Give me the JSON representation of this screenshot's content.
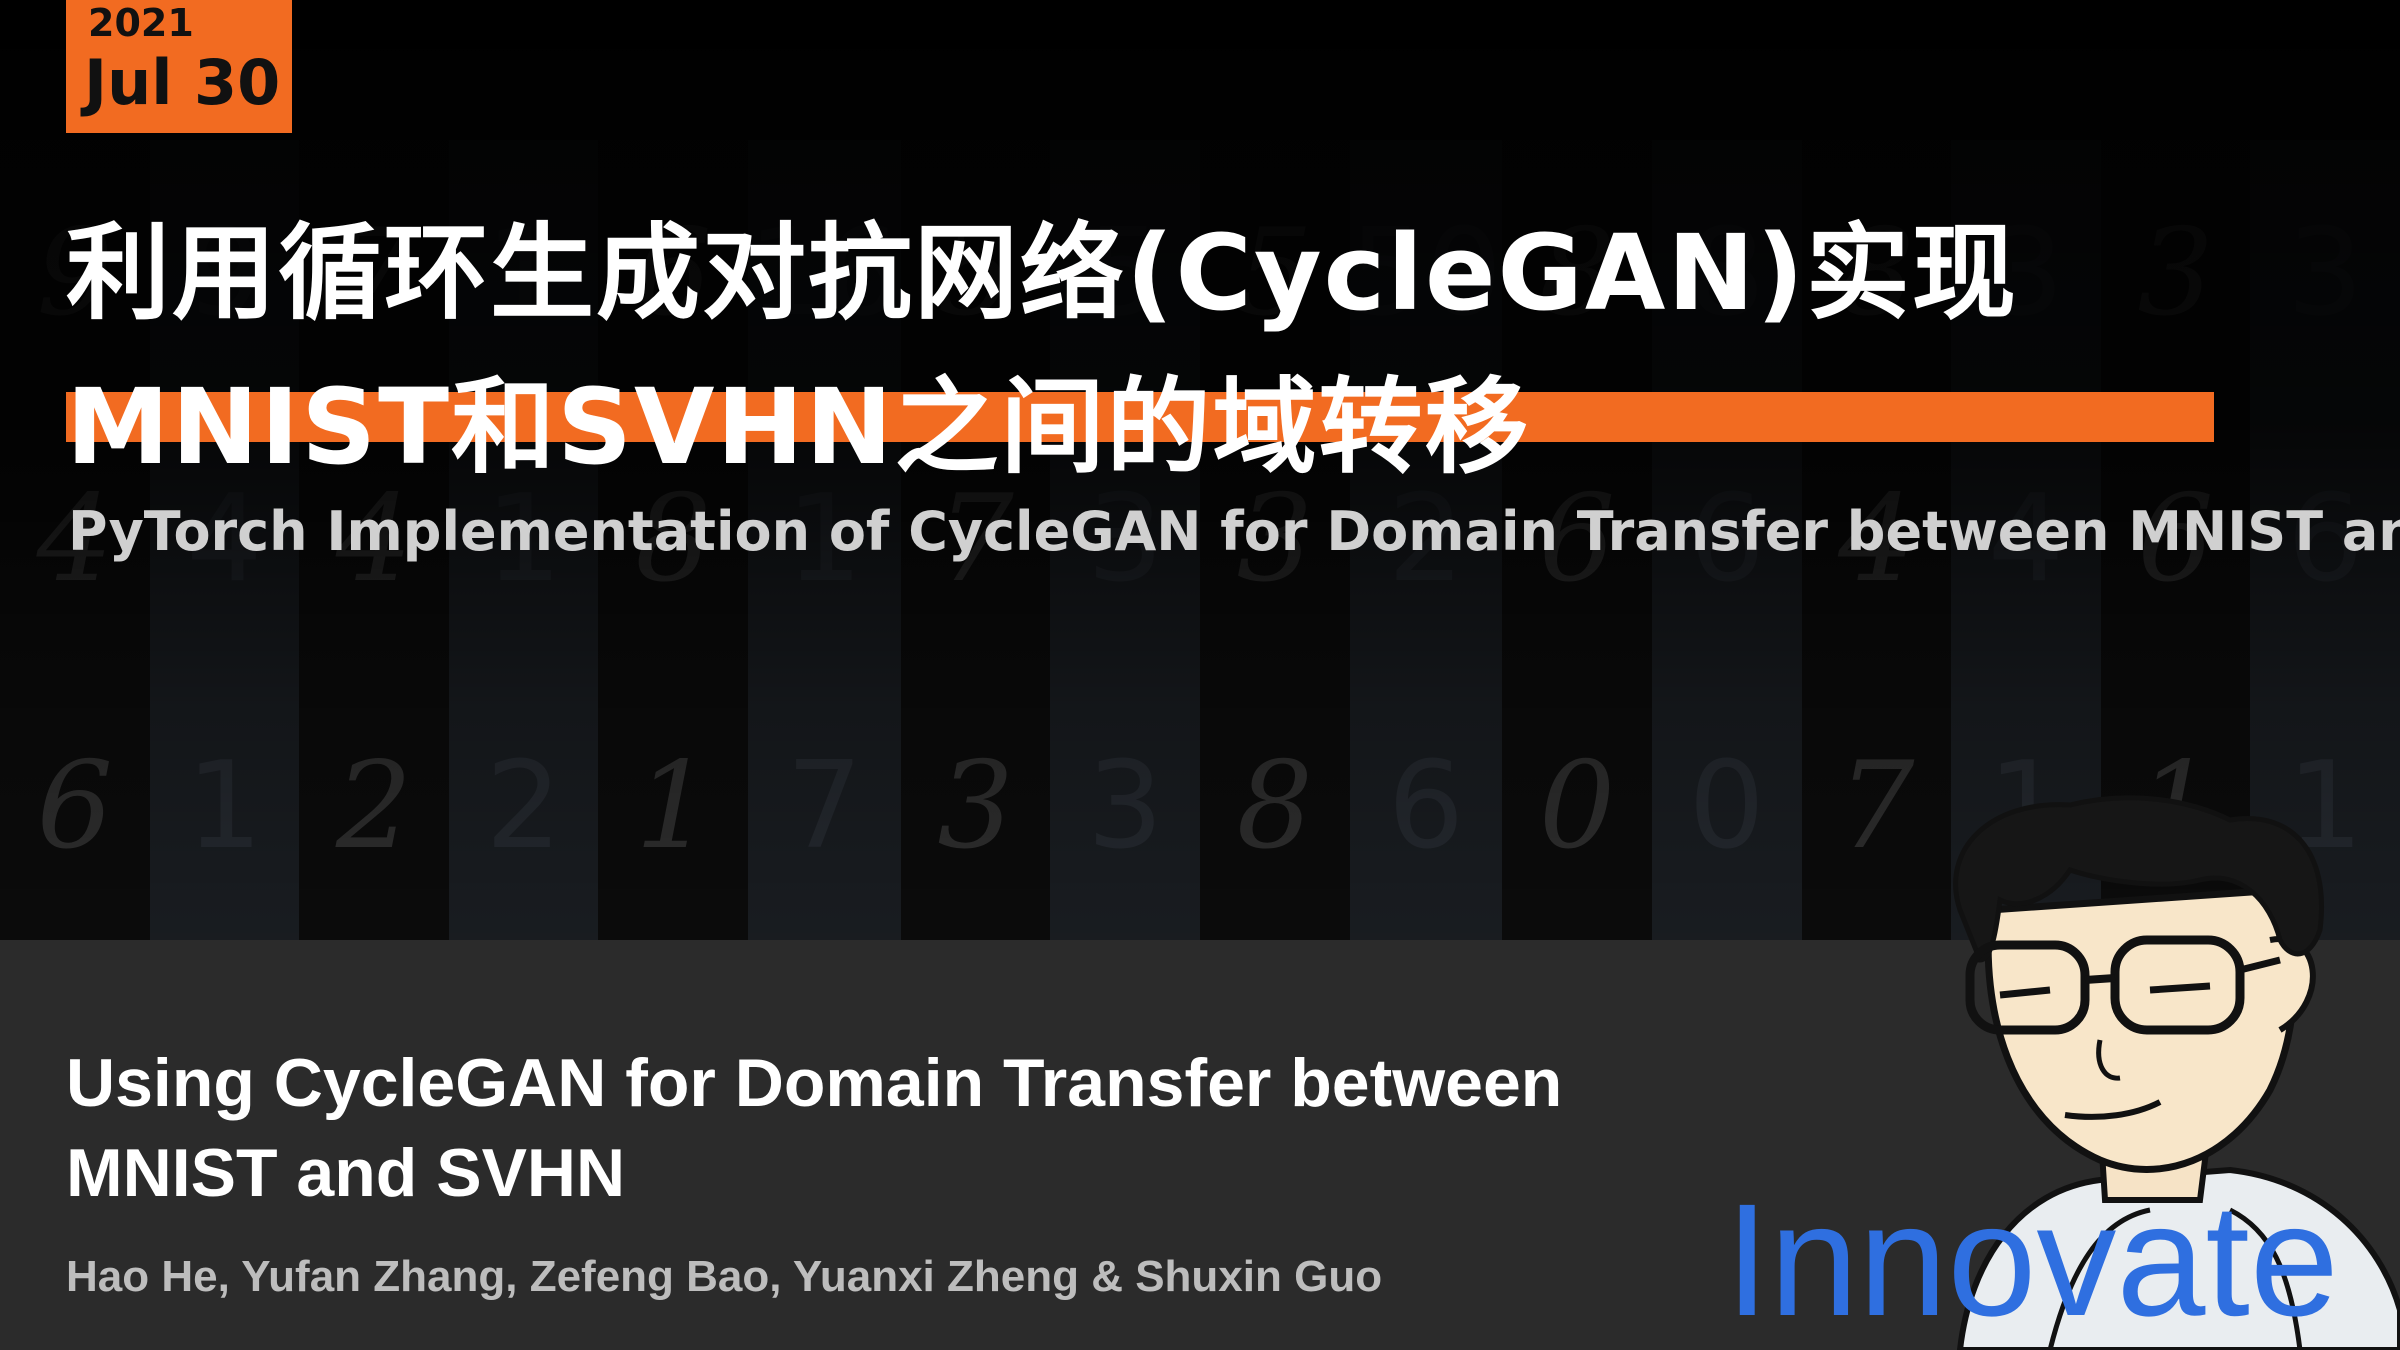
{
  "date": {
    "year": "2021",
    "day": "Jul 30"
  },
  "title_cn": {
    "line1": "利用循环生成对抗网络(CycleGAN)实现",
    "line2": "MNIST和SVHN之间的域转移"
  },
  "subtitle_en": "PyTorch Implementation of CycleGAN for Domain Transfer between MNIST and SVHN",
  "lower": {
    "title_line1": "Using CycleGAN for Domain Transfer between",
    "title_line2": "MNIST and SVHN",
    "authors": "Hao He, Yufan Zhang, Zefeng Bao, Yuanxi Zheng & Shuxin Guo"
  },
  "brand": "Innovate",
  "colors": {
    "accent": "#f26b21",
    "brand": "#2f6fe0",
    "panel": "#2b2b2b"
  },
  "tiles": [
    {
      "kind": "mnist",
      "digits": [
        "9",
        "4",
        "6"
      ]
    },
    {
      "kind": "svhn",
      "digits": [
        "9",
        "4",
        "1"
      ]
    },
    {
      "kind": "mnist",
      "digits": [
        "7",
        "4",
        "2"
      ]
    },
    {
      "kind": "svhn",
      "digits": [
        "1",
        "1",
        "2"
      ]
    },
    {
      "kind": "mnist",
      "digits": [
        "6",
        "8",
        "1"
      ]
    },
    {
      "kind": "svhn",
      "digits": [
        "16",
        "1",
        "7"
      ]
    },
    {
      "kind": "mnist",
      "digits": [
        "5",
        "7",
        "3"
      ]
    },
    {
      "kind": "svhn",
      "digits": [
        "5",
        "3",
        "3"
      ]
    },
    {
      "kind": "mnist",
      "digits": [
        "5",
        "3",
        "8"
      ]
    },
    {
      "kind": "svhn",
      "digits": [
        "50",
        "2",
        "6"
      ]
    },
    {
      "kind": "mnist",
      "digits": [
        "8",
        "6",
        "0"
      ]
    },
    {
      "kind": "svhn",
      "digits": [
        "8",
        "6",
        "0"
      ]
    },
    {
      "kind": "mnist",
      "digits": [
        "8",
        "4",
        "7"
      ]
    },
    {
      "kind": "svhn",
      "digits": [
        "3",
        "4",
        "1"
      ]
    },
    {
      "kind": "mnist",
      "digits": [
        "3",
        "6",
        "1"
      ]
    },
    {
      "kind": "svhn",
      "digits": [
        "3",
        "6",
        "1"
      ]
    }
  ]
}
